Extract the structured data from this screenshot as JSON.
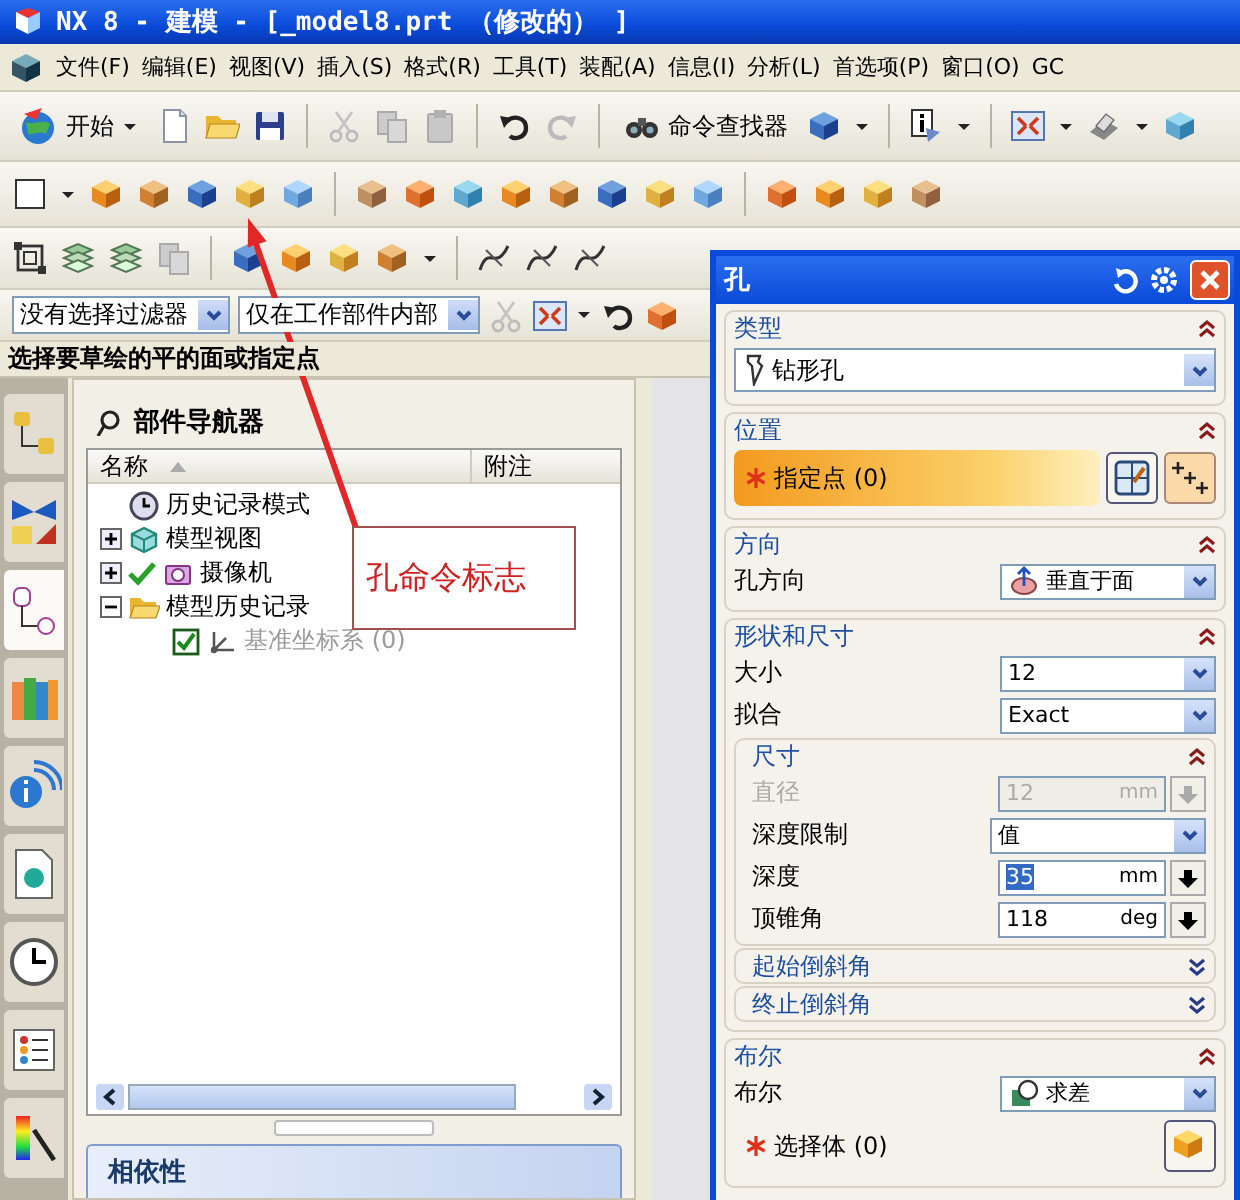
{
  "window": {
    "title": "NX 8 - 建模 - [_model8.prt （修改的） ]"
  },
  "menu": [
    {
      "label": "文件(F)"
    },
    {
      "label": "编辑(E)"
    },
    {
      "label": "视图(V)"
    },
    {
      "label": "插入(S)"
    },
    {
      "label": "格式(R)"
    },
    {
      "label": "工具(T)"
    },
    {
      "label": "装配(A)"
    },
    {
      "label": "信息(I)"
    },
    {
      "label": "分析(L)"
    },
    {
      "label": "首选项(P)"
    },
    {
      "label": "窗口(O)"
    },
    {
      "label": "GC"
    }
  ],
  "toolbar": {
    "start_label": "开始",
    "command_finder_label": "命令查找器"
  },
  "filters": [
    {
      "value": "没有选择过滤器"
    },
    {
      "value": "仅在工作部件内部"
    }
  ],
  "prompt": "选择要草绘的平的面或指定点",
  "resource_tabs": [
    {
      "selected": false
    },
    {
      "selected": false
    },
    {
      "selected": true
    },
    {
      "selected": false
    },
    {
      "selected": false
    },
    {
      "selected": false
    },
    {
      "selected": false
    },
    {
      "selected": false
    },
    {
      "selected": false
    }
  ],
  "part_navigator": {
    "title": "部件导航器",
    "columns": [
      "名称",
      "附注"
    ],
    "tree": [
      {
        "kind": "mode",
        "label": "历史记录模式",
        "checked": false,
        "disabled": false
      },
      {
        "kind": "views",
        "label": "模型视图",
        "expanded": false,
        "checked": false,
        "disabled": false
      },
      {
        "kind": "cameras",
        "label": "摄像机",
        "expanded": false,
        "checked": true,
        "disabled": false
      },
      {
        "kind": "history",
        "label": "模型历史记录",
        "expanded": true,
        "checked": false,
        "disabled": false,
        "children": [
          {
            "kind": "datum",
            "label": "基准坐标系 (0)",
            "checked": true,
            "disabled": true
          }
        ]
      }
    ],
    "dependencies_title": "相依性"
  },
  "annotation": {
    "text": "孔命令标志"
  },
  "dialog": {
    "title": "孔",
    "sections": [
      {
        "title": "类型",
        "expanded": true,
        "rows": [
          {
            "kind": "select",
            "value": "钻形孔"
          }
        ]
      },
      {
        "title": "位置",
        "expanded": true,
        "rows": [
          {
            "kind": "point-selector",
            "label": "指定点 (0)",
            "active": true
          }
        ]
      },
      {
        "title": "方向",
        "expanded": true,
        "rows": [
          {
            "kind": "select",
            "label": "孔方向",
            "value": "垂直于面"
          }
        ]
      },
      {
        "title": "形状和尺寸",
        "expanded": true,
        "rows": [
          {
            "kind": "select",
            "label": "大小",
            "value": "12"
          },
          {
            "kind": "select",
            "label": "拟合",
            "value": "Exact"
          },
          {
            "kind": "group",
            "title": "尺寸",
            "expanded": true,
            "rows": [
              {
                "kind": "number",
                "label": "直径",
                "value": "12",
                "unit": "mm",
                "disabled": true,
                "selected": false
              },
              {
                "kind": "select",
                "label": "深度限制",
                "value": "值"
              },
              {
                "kind": "number",
                "label": "深度",
                "value": "35",
                "unit": "mm",
                "disabled": false,
                "selected": true
              },
              {
                "kind": "number",
                "label": "顶锥角",
                "value": "118",
                "unit": "deg",
                "disabled": false,
                "selected": false
              }
            ]
          },
          {
            "kind": "group",
            "title": "起始倒斜角",
            "expanded": false
          },
          {
            "kind": "group",
            "title": "终止倒斜角",
            "expanded": false
          }
        ]
      },
      {
        "title": "布尔",
        "expanded": true,
        "rows": [
          {
            "kind": "select",
            "label": "布尔",
            "value": "求差"
          },
          {
            "kind": "body-selector",
            "label": "选择体 (0)",
            "active": false
          }
        ]
      }
    ]
  }
}
